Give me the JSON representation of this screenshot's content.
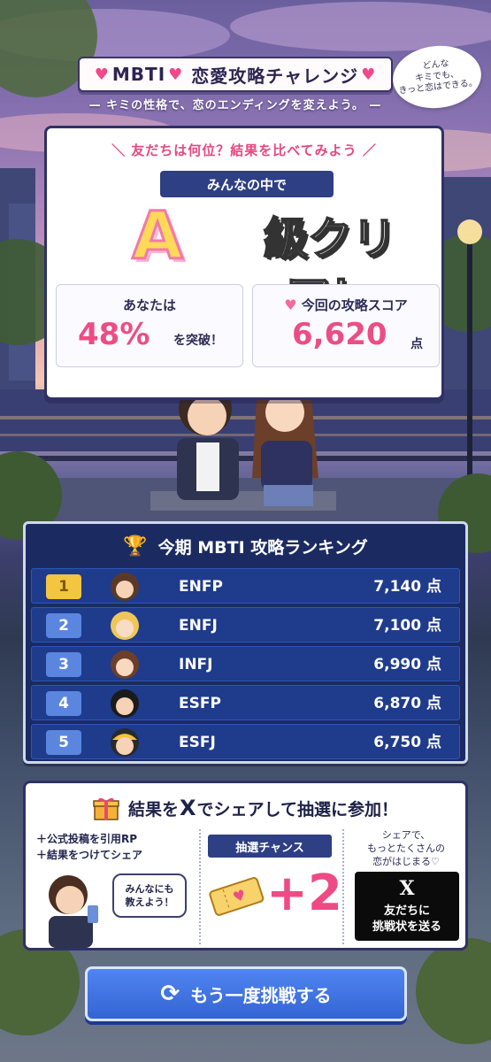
{
  "header": {
    "title": "MBTI♥ 恋愛攻略チャレンジ",
    "title_main": "MBTI",
    "title_sub": "恋愛攻略チャレンジ",
    "subtitle": "— キミの性格で、恋のエンディングを変えよう。 —",
    "bubble_note": "どんな\nキミでも、\nきっと恋はできる。"
  },
  "result": {
    "compare_line": "＼ 友だちは何位？結果を比べてみよう ／",
    "among_label": "みんなの中で",
    "grade": "A",
    "grade_suffix": "級クリア！",
    "percentile_label": "あなたは",
    "percentile_value": "48%",
    "percentile_suffix": "を突破！",
    "score_label": "今回の攻略スコア",
    "score_value": "6,620",
    "score_unit": "点"
  },
  "ranking": {
    "title": "今期 MBTI 攻略ランキング",
    "rows": [
      {
        "rank": "1",
        "type": "ENFP",
        "score": "7,140 点"
      },
      {
        "rank": "2",
        "type": "ENFJ",
        "score": "7,100 点"
      },
      {
        "rank": "3",
        "type": "INFJ",
        "score": "6,990 点"
      },
      {
        "rank": "4",
        "type": "ESFP",
        "score": "6,870 点"
      },
      {
        "rank": "5",
        "type": "ESFJ",
        "score": "6,750 点"
      }
    ]
  },
  "share": {
    "title_pre": "結果を",
    "title_x": "X",
    "title_post": "でシェアして抽選に参加！",
    "step1": "＋公式投稿を引用RP",
    "step2": "＋結果をつけてシェア",
    "speech": "みんなにも\n教えよう！",
    "chance_label": "抽選チャンス",
    "chance_value": "+2",
    "note": "シェアで、\nもっとたくさんの\n恋がはじまる♡",
    "x_logo": "X",
    "x_button_label": "友だちに\n挑戦状を送る"
  },
  "retry": {
    "label": "もう一度挑戦する"
  },
  "colors": {
    "accent_pink": "#ec4d84",
    "navy": "#1b2b62",
    "gold": "#f3c540",
    "button_blue": "#3f74e2"
  },
  "icons": [
    "heart-icon",
    "trophy-icon",
    "gift-icon",
    "ticket-icon",
    "x-logo-icon",
    "refresh-icon"
  ]
}
